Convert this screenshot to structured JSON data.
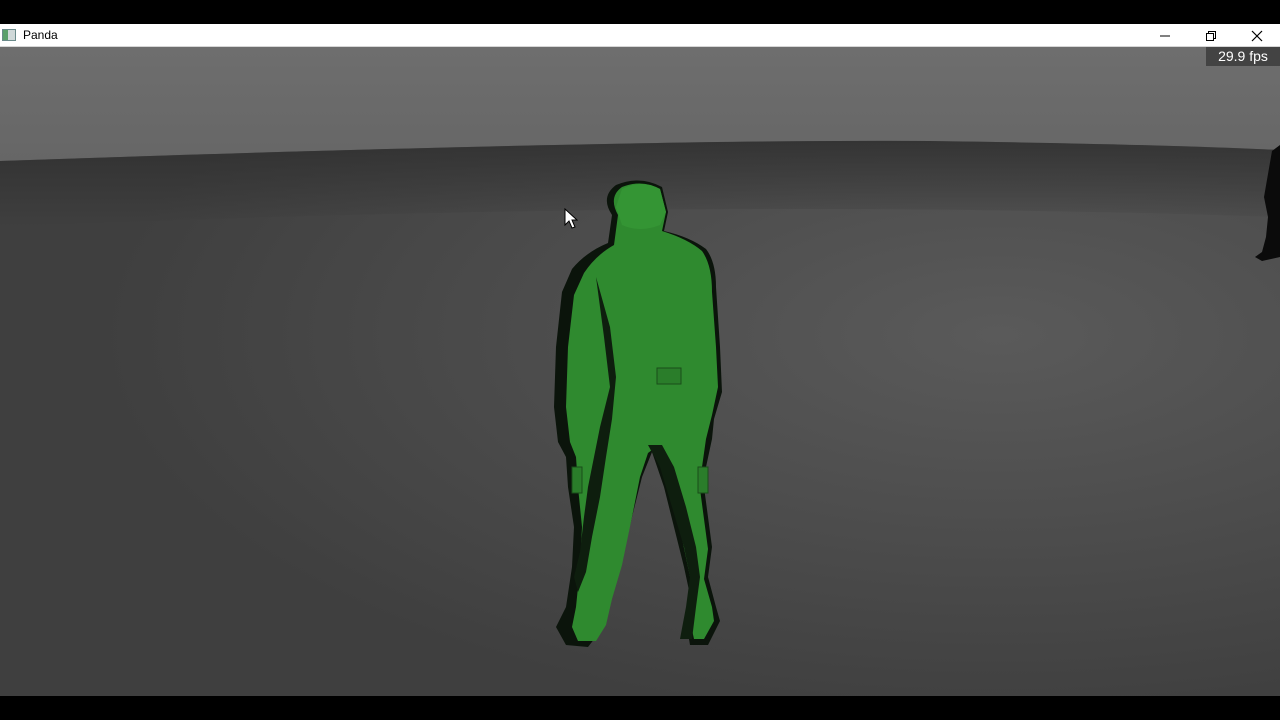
{
  "window": {
    "title": "Panda",
    "icons": {
      "app": "panda-app-icon",
      "minimize": "minimize-icon",
      "restore": "restore-icon",
      "close": "close-icon"
    }
  },
  "overlay": {
    "fps": "29.9 fps"
  },
  "scene": {
    "sky_color": "#6b6b6b",
    "ground_color": "#474747",
    "character_color": "#2f8a2f",
    "character_shadow_color": "#0a140a"
  }
}
